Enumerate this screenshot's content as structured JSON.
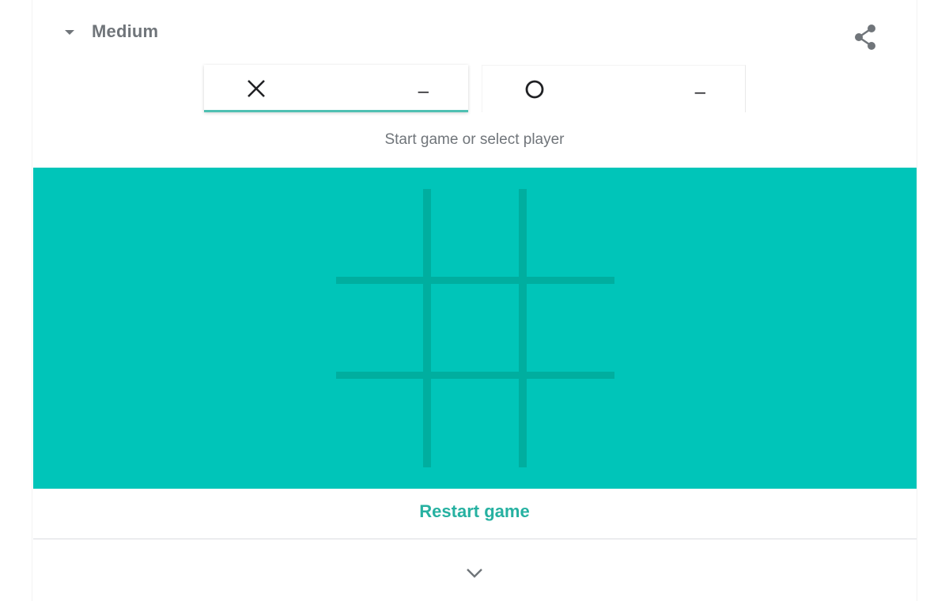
{
  "header": {
    "difficulty_label": "Medium",
    "difficulty_icon": "caret-down-icon",
    "share_icon": "share-icon"
  },
  "players": [
    {
      "symbol": "X",
      "score": "–",
      "selected": true
    },
    {
      "symbol": "O",
      "score": "–",
      "selected": false
    }
  ],
  "status_text": "Start game or select player",
  "board": {
    "cells": [
      "",
      "",
      "",
      "",
      "",
      "",
      "",
      "",
      ""
    ]
  },
  "restart_label": "Restart game",
  "footer": {
    "expand_icon": "chevron-down-icon"
  },
  "colors": {
    "board_background": "#00c5b9",
    "grid_lines": "#00ae9f",
    "accent": "#26b1a1",
    "muted_text": "#70757a"
  }
}
